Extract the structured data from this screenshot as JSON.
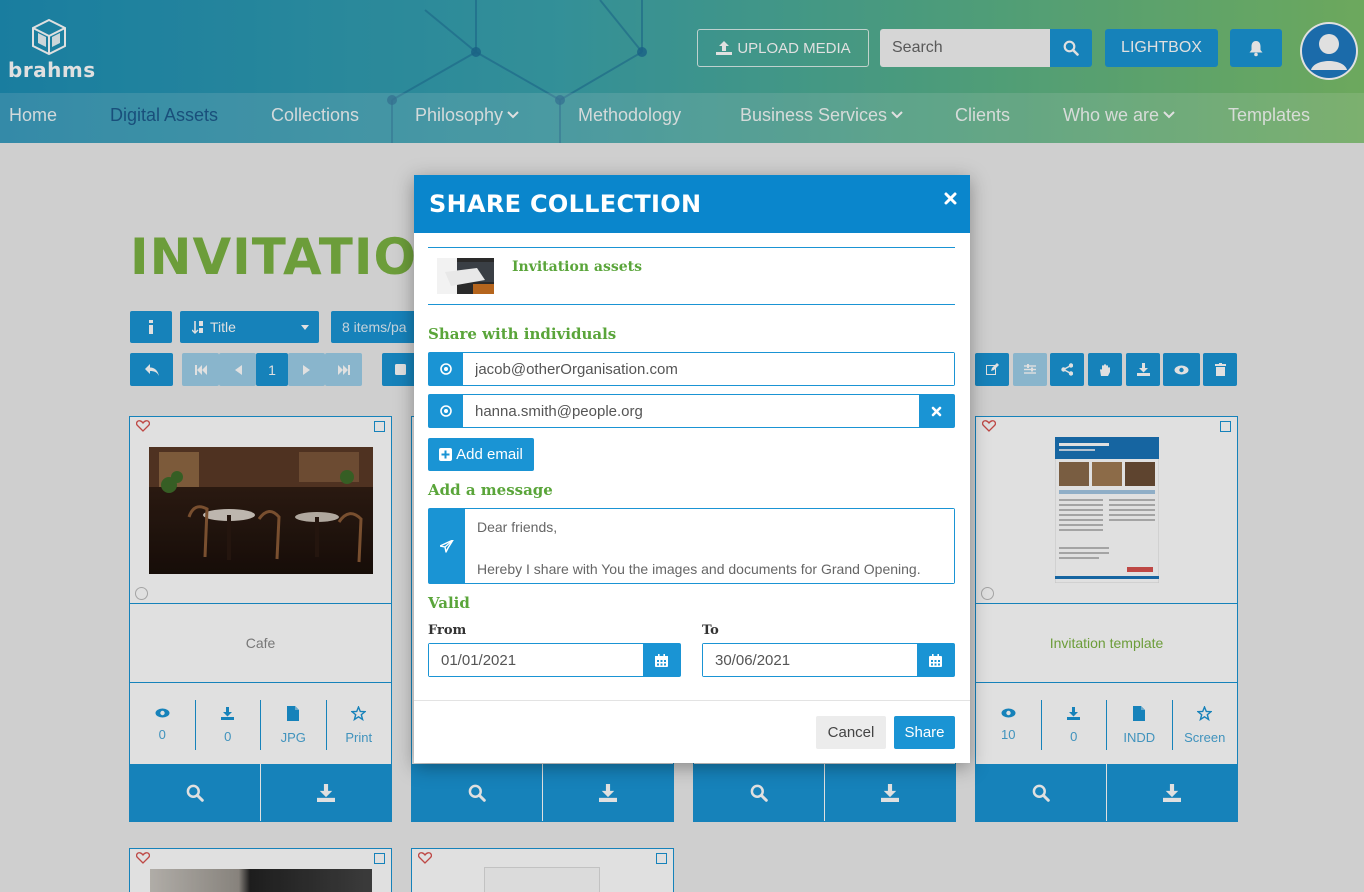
{
  "brand": {
    "name": "brahms"
  },
  "header": {
    "upload_label": "UPLOAD MEDIA",
    "search_placeholder": "Search",
    "lightbox_label": "LIGHTBOX"
  },
  "nav": {
    "items": [
      {
        "label": "Home"
      },
      {
        "label": "Digital Assets",
        "active": true
      },
      {
        "label": "Collections"
      },
      {
        "label": "Philosophy",
        "dropdown": true
      },
      {
        "label": "Methodology"
      },
      {
        "label": "Business Services",
        "dropdown": true
      },
      {
        "label": "Clients"
      },
      {
        "label": "Who we are",
        "dropdown": true
      },
      {
        "label": "Templates"
      }
    ]
  },
  "page": {
    "title": "INVITATION",
    "sort_label": "Title",
    "per_page_label": "8 items/pa",
    "current_page": "1"
  },
  "cards": [
    {
      "name": "Cafe",
      "views": "0",
      "downloads": "0",
      "format": "JPG",
      "usage": "Print"
    },
    {
      "name": "Invitation template",
      "views": "10",
      "downloads": "0",
      "format": "INDD",
      "usage": "Screen"
    }
  ],
  "modal": {
    "title": "SHARE COLLECTION",
    "collection_name": "Invitation assets",
    "share_individuals_label": "Share with individuals",
    "emails": [
      "jacob@otherOrganisation.com",
      "hanna.smith@people.org"
    ],
    "add_email_label": "Add email",
    "message_label": "Add a message",
    "message": "Dear friends,\n\nHereby I share with You the images and documents for Grand Opening.",
    "valid_label": "Valid",
    "from_label": "From",
    "to_label": "To",
    "from_date": "01/01/2021",
    "to_date": "30/06/2021",
    "cancel_label": "Cancel",
    "share_label": "Share"
  },
  "colors": {
    "primary": "#1a94d4",
    "accent_green": "#7cb342",
    "header_blue": "#0a86cc"
  },
  "icons": [
    "upload-icon",
    "search-icon",
    "bell-icon",
    "user-icon",
    "close-icon",
    "at-icon",
    "plus-square-icon",
    "paper-plane-icon",
    "calendar-icon",
    "eye-icon",
    "download-icon",
    "file-icon",
    "star-icon",
    "heart-icon"
  ]
}
